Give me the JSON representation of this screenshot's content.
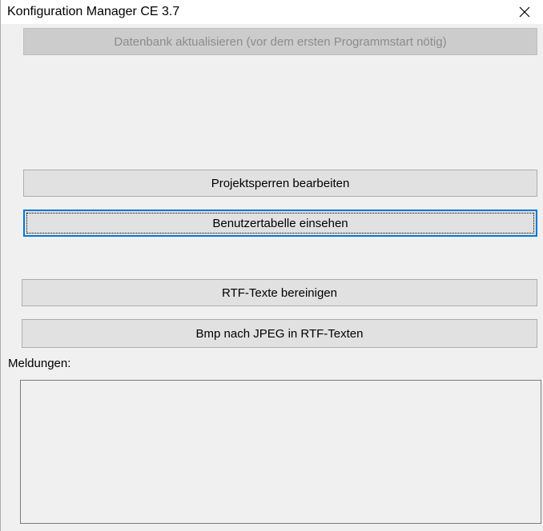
{
  "window": {
    "title": "Konfiguration Manager CE 3.7"
  },
  "buttons": {
    "update_db": "Datenbank aktualisieren (vor dem ersten Programmstart nötig)",
    "project_locks": "Projektsperren bearbeiten",
    "user_table": "Benutzertabelle einsehen",
    "rtf_clean": "RTF-Texte bereinigen",
    "bmp_jpeg": "Bmp nach JPEG in RTF-Texten"
  },
  "messages": {
    "label": "Meldungen:",
    "value": ""
  },
  "icons": {
    "close": "close-icon"
  },
  "colors": {
    "window_bg": "#f0f0f0",
    "button_bg": "#e1e1e1",
    "focus_border": "#0078d7",
    "disabled_text": "#8c8c8c"
  }
}
